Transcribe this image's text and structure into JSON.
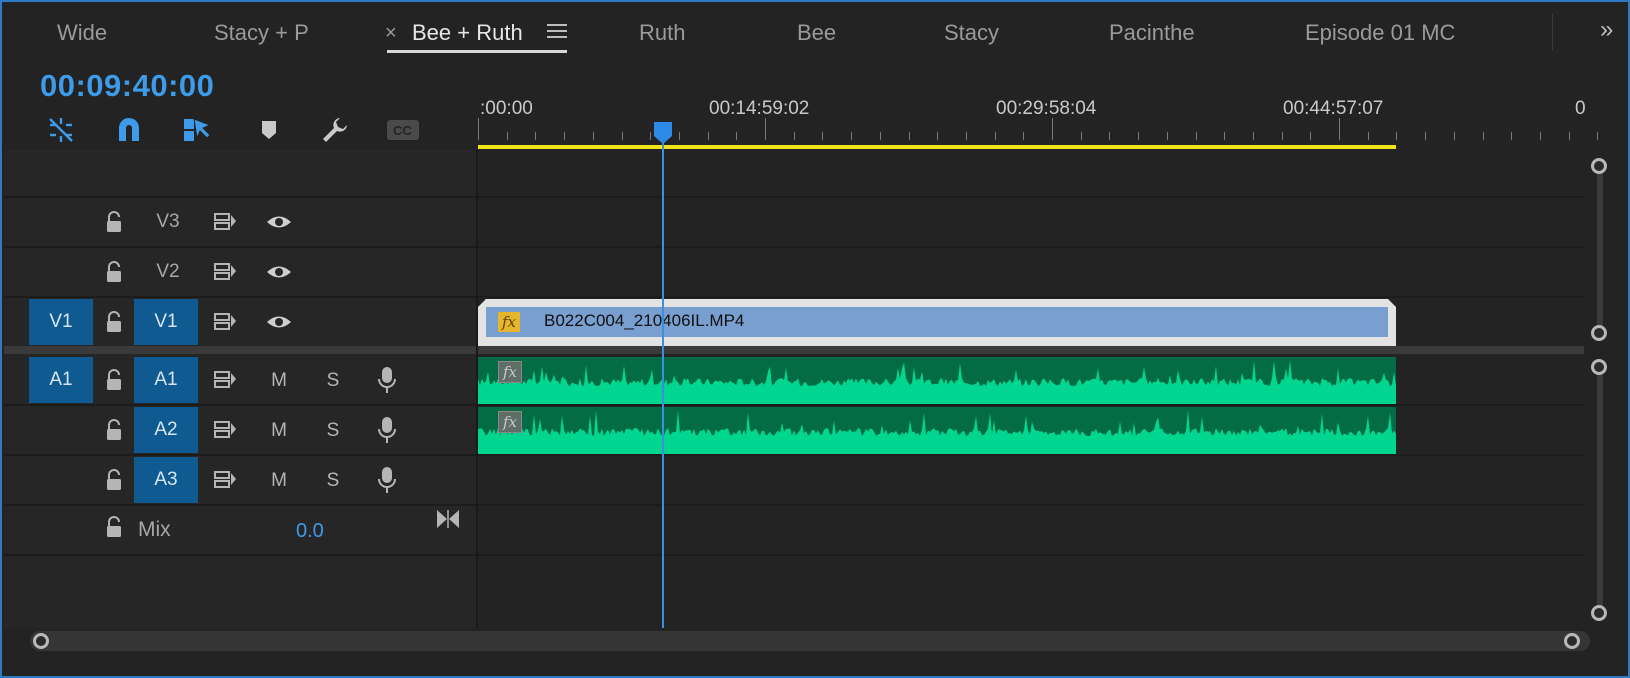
{
  "tabs": [
    {
      "label": "Wide"
    },
    {
      "label": "Stacy + P"
    },
    {
      "label": "Bee + Ruth",
      "active": true
    },
    {
      "label": "Ruth"
    },
    {
      "label": "Bee"
    },
    {
      "label": "Stacy"
    },
    {
      "label": "Pacinthe"
    },
    {
      "label": "Episode 01 MC"
    }
  ],
  "tab_close_glyph": "×",
  "overflow_glyph": "»",
  "timecode": "00:09:40:00",
  "toolbar": {
    "icons": [
      "nest-sequence-icon",
      "snap-magnet-icon",
      "linked-selection-icon",
      "add-marker-icon",
      "timeline-settings-wrench-icon",
      "captions-cc-icon"
    ],
    "cc_label": "CC"
  },
  "ruler": {
    "labels": [
      ":00:00",
      "00:14:59:02",
      "00:29:58:04",
      "00:44:57:07",
      "0"
    ]
  },
  "tracks": {
    "video": [
      {
        "name": "V3",
        "source": "",
        "targeted": false
      },
      {
        "name": "V2",
        "source": "",
        "targeted": false
      },
      {
        "name": "V1",
        "source": "V1",
        "targeted": true
      }
    ],
    "audio": [
      {
        "name": "A1",
        "source": "A1",
        "targeted": true,
        "mute": "M",
        "solo": "S"
      },
      {
        "name": "A2",
        "source": "",
        "targeted": true,
        "mute": "M",
        "solo": "S"
      },
      {
        "name": "A3",
        "source": "",
        "targeted": true,
        "mute": "M",
        "solo": "S"
      }
    ],
    "mix": {
      "label": "Mix",
      "value": "0.0"
    }
  },
  "clips": {
    "video_clip_name": "B022C004_210406IL.MP4",
    "fx_label": "fx"
  },
  "colors": {
    "accent": "#3d9be9",
    "target_blue": "#0f5a90",
    "video_clip": "#789fd0",
    "audio_clip_bg": "#036c45",
    "audio_wave": "#00d68f",
    "work_area": "#f2e316"
  }
}
